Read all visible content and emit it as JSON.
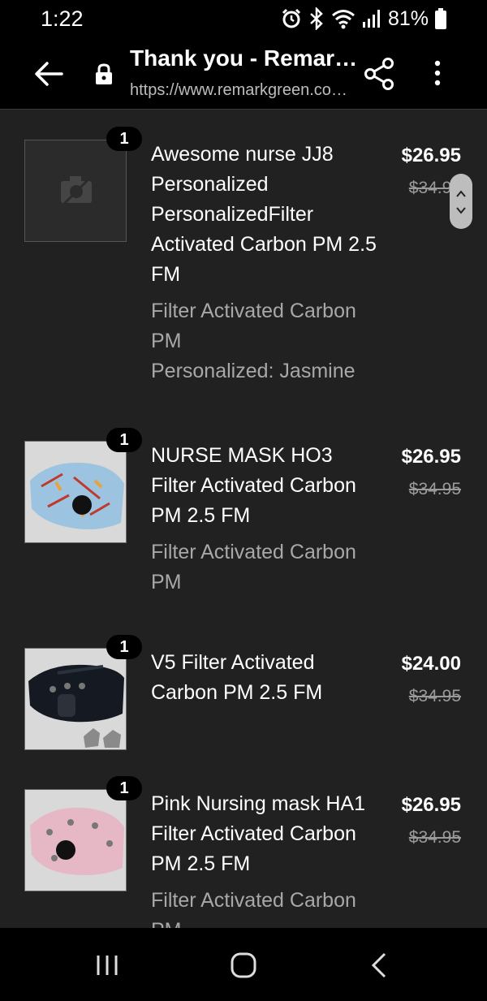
{
  "status": {
    "time": "1:22",
    "battery": "81%"
  },
  "toolbar": {
    "title": "Thank you - Remark…",
    "url": "https://www.remarkgreen.co…"
  },
  "order_items": [
    {
      "quantity": "1",
      "name": "Awesome nurse JJ8 Personalized PersonalizedFilter Activated Carbon PM 2.5 FM",
      "variant_lines": [
        "Filter Activated Carbon PM",
        "Personalized: Jasmine"
      ],
      "price": "$26.95",
      "compare_price": "$34.95",
      "image": "no-image-placeholder"
    },
    {
      "quantity": "1",
      "name": "NURSE MASK HO3 Filter Activated Carbon PM 2.5 FM",
      "variant_lines": [
        "Filter Activated Carbon PM"
      ],
      "price": "$26.95",
      "compare_price": "$34.95",
      "image": "blue-nurse-print-mask"
    },
    {
      "quantity": "1",
      "name": "V5 Filter Activated Carbon PM 2.5 FM",
      "variant_lines": [],
      "price": "$24.00",
      "compare_price": "$34.95",
      "image": "black-sport-mask"
    },
    {
      "quantity": "1",
      "name": "Pink Nursing mask HA1 Filter Activated Carbon PM 2.5 FM",
      "variant_lines": [
        "Filter Activated Carbon PM"
      ],
      "price": "$26.95",
      "compare_price": "$34.95",
      "image": "pink-nurse-print-mask"
    }
  ],
  "icons": {
    "back": "arrow-left-icon",
    "lock": "lock-icon",
    "share": "share-icon",
    "menu": "more-vert-icon",
    "nav": [
      "recent-apps-icon",
      "home-icon",
      "back-icon"
    ]
  }
}
